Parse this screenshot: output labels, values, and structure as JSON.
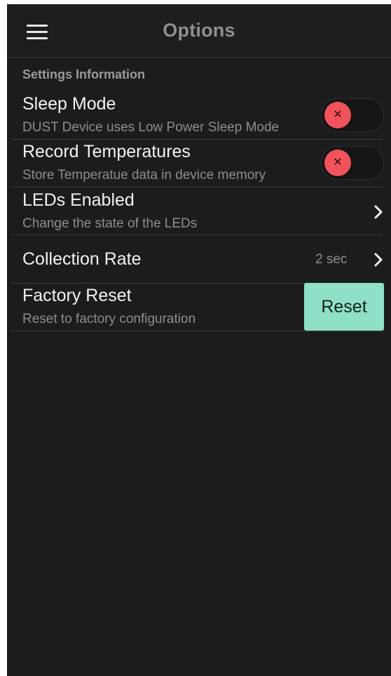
{
  "header": {
    "title": "Options",
    "menu_icon": "hamburger-menu-icon"
  },
  "section": {
    "title": "Settings Information"
  },
  "settings": [
    {
      "label": "Sleep Mode",
      "description": "DUST Device uses Low Power Sleep Mode",
      "control": "toggle",
      "enabled": false
    },
    {
      "label": "Record Temperatures",
      "description": "Store Temperatue data in device memory",
      "control": "toggle",
      "enabled": false
    },
    {
      "label": "LEDs Enabled",
      "description": "Change the state of the LEDs",
      "control": "chevron"
    },
    {
      "label": "Collection Rate",
      "value": "2 sec",
      "control": "chevron"
    },
    {
      "label": "Factory Reset",
      "description": "Reset to factory configuration",
      "control": "button",
      "button_label": "Reset"
    }
  ],
  "colors": {
    "background": "#1c1c1e",
    "toggle_off_knob": "#f2525a",
    "reset_button": "#8ee0c8"
  }
}
